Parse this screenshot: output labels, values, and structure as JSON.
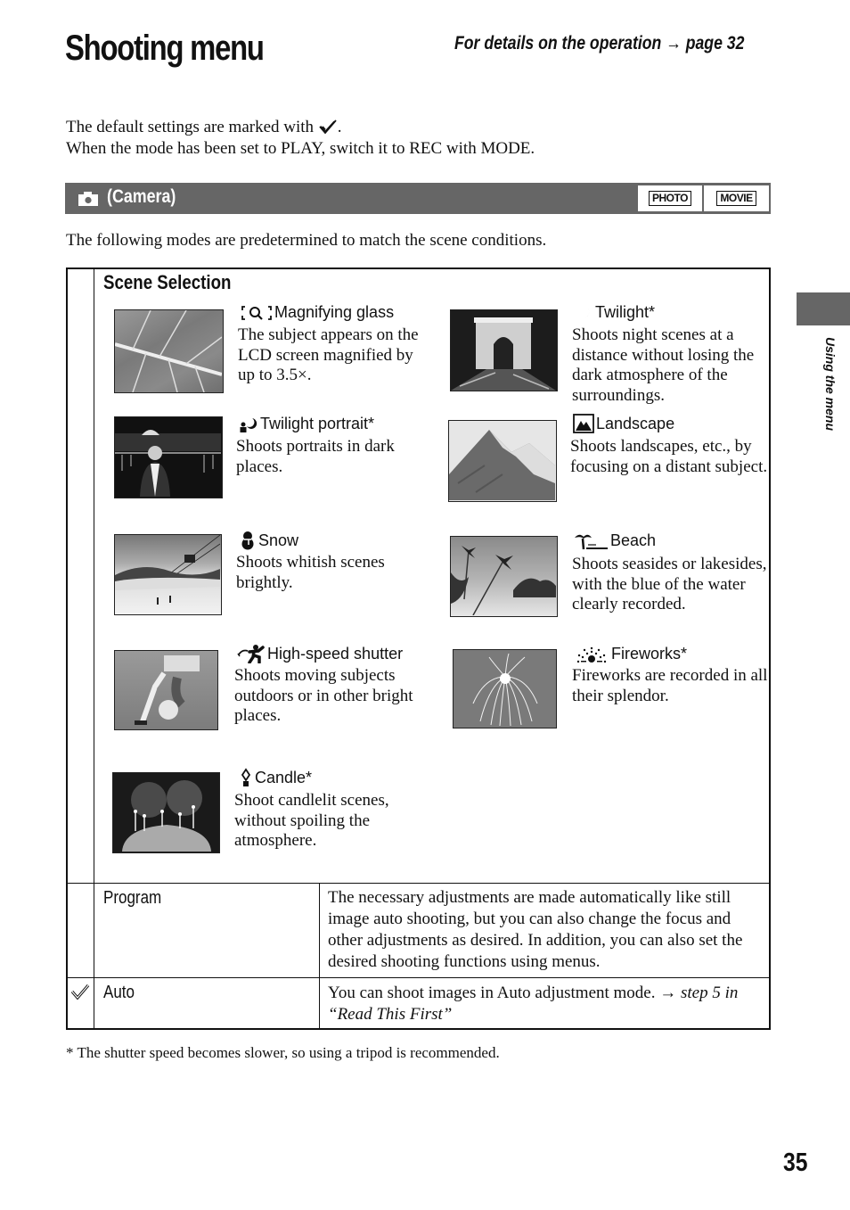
{
  "header": {
    "title": "Shooting menu",
    "reference": "For details on the operation → page 32"
  },
  "intro": {
    "line1": "The default settings are marked with",
    "line1_end": ".",
    "line2": "When the mode has been set to PLAY, switch it to REC with MODE."
  },
  "section": {
    "icon": "camera-icon",
    "title": "(Camera)",
    "modes": [
      "PHOTO",
      "MOVIE"
    ],
    "bar_color": "#666666"
  },
  "lead_text": "The following modes are predetermined to match the scene conditions.",
  "side_tab": {
    "label": "Using the menu",
    "color": "#666666"
  },
  "scene_selection": {
    "heading": "Scene Selection",
    "scenes": [
      {
        "icon": "magnifying-glass-icon",
        "name": "Magnifying glass",
        "desc": "The subject appears on the LCD screen magnified by up to 3.5×.",
        "thumb": "leaf veins"
      },
      {
        "icon": "twilight-icon",
        "name": "Twilight*",
        "desc": "Shoots night scenes at a distance without losing the dark atmosphere of the surroundings.",
        "thumb": "arc de triomphe at night"
      },
      {
        "icon": "twilight-portrait-icon",
        "name": "Twilight portrait*",
        "desc": "Shoots portraits in dark places.",
        "thumb": "woman at night by water"
      },
      {
        "icon": "landscape-icon",
        "name": "Landscape",
        "desc": "Shoots landscapes, etc., by focusing on a distant subject.",
        "thumb": "mountain peak"
      },
      {
        "icon": "snow-icon",
        "name": "Snow",
        "desc": "Shoots whitish scenes brightly.",
        "thumb": "ski slope with gondola"
      },
      {
        "icon": "beach-icon",
        "name": "Beach",
        "desc": "Shoots seasides or lakesides, with the blue of the water clearly recorded.",
        "thumb": "palm trees on beach"
      },
      {
        "icon": "high-speed-shutter-icon",
        "name": "High-speed shutter",
        "desc": "Shoots moving subjects outdoors or in other bright places.",
        "thumb": "soccer player kicking ball"
      },
      {
        "icon": "fireworks-icon",
        "name": "Fireworks*",
        "desc": "Fireworks are recorded in all their splendor.",
        "thumb": "fireworks burst"
      },
      {
        "icon": "candle-icon",
        "name": "Candle*",
        "desc": "Shoot candlelit scenes, without spoiling the atmosphere.",
        "thumb": "children with birthday cake"
      }
    ]
  },
  "rows": [
    {
      "label": "Program",
      "default": false,
      "desc": "The necessary adjustments are made automatically like still image auto shooting, but you can also change the focus and other adjustments as desired. In addition, you can also set the desired shooting functions using menus."
    },
    {
      "label": "Auto",
      "default": true,
      "desc": "You can shoot images in Auto adjustment mode. →",
      "desc_ref": "step 5 in “Read This First”"
    }
  ],
  "footnote": "* The shutter speed becomes slower, so using a tripod is recommended.",
  "page_number": "35"
}
